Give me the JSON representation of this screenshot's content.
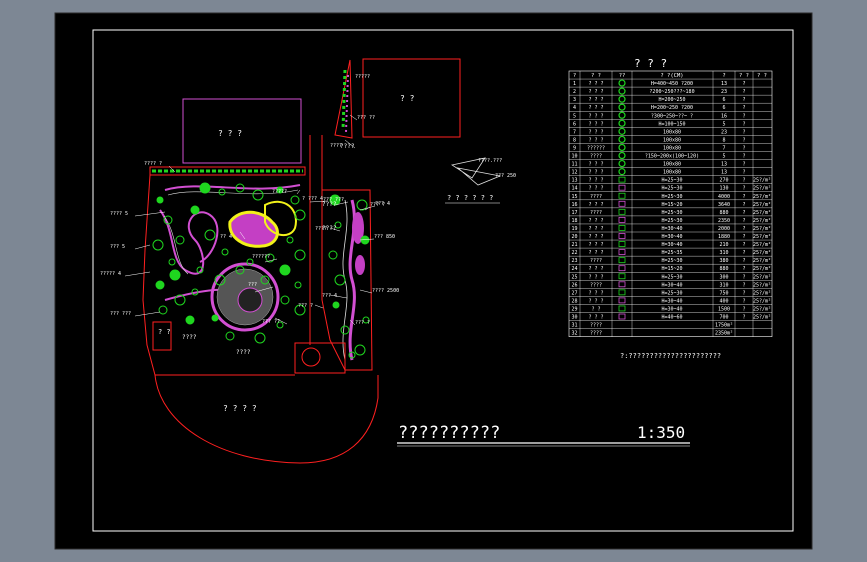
{
  "drawing": {
    "title": "??????????",
    "scale": "1:350",
    "note": "?:??????????????????????",
    "legend_title": "? ? ?",
    "detail_label": "? ? ? ? ? ?",
    "detail_annotations": [
      "????.???",
      "??? 250"
    ]
  },
  "plan_labels": {
    "building_top_left": "? ? ?",
    "building_top_right": "? ?",
    "lawn_south": "? ? ? ?",
    "entry": "????",
    "plaza": "????",
    "gate": "? ?",
    "north": "?????",
    "walk": "????",
    "drive": "????",
    "bridge": "????"
  },
  "callouts": [
    "???? ?",
    "???? 5",
    "??? 5",
    "????? 4",
    "??? ???",
    "?????",
    "?? 4",
    "??????",
    "???",
    "??? ??",
    "????",
    "????",
    "??? ?",
    "??? 4",
    "??? 4",
    "???? 2500",
    "??? 850",
    "??? ?",
    "??? ??",
    "? ??? 4",
    "??? ???",
    "??? ?"
  ],
  "table": {
    "headers": [
      "?",
      "? ?",
      "??",
      "? ?(CM)",
      "?",
      "? ?",
      "? ?"
    ],
    "rows": [
      [
        "1",
        "? ? ?",
        "",
        "H=400~450 ?200",
        "13",
        "?",
        ""
      ],
      [
        "2",
        "? ? ?",
        "",
        "?200~250???~180",
        "23",
        "?",
        ""
      ],
      [
        "3",
        "? ? ?",
        "",
        "H=200~250",
        "6",
        "?",
        ""
      ],
      [
        "4",
        "? ? ?",
        "",
        "H=200~250 ?200",
        "6",
        "?",
        ""
      ],
      [
        "5",
        "? ? ?",
        "",
        "?300~250~??~ ?",
        "16",
        "?",
        ""
      ],
      [
        "6",
        "? ? ?",
        "",
        "H=100~150",
        "5",
        "?",
        ""
      ],
      [
        "7",
        "? ? ?",
        "",
        "100x80",
        "23",
        "?",
        ""
      ],
      [
        "8",
        "? ? ?",
        "",
        "100x80",
        "8",
        "?",
        ""
      ],
      [
        "9",
        "??????",
        "",
        "100x80",
        "7",
        "?",
        ""
      ],
      [
        "10",
        "????",
        "",
        "?150~200x(100~120)",
        "5",
        "?",
        ""
      ],
      [
        "11",
        "? ? ?",
        "",
        "100x80",
        "13",
        "?",
        ""
      ],
      [
        "12",
        "? ? ?",
        "",
        "100x80",
        "13",
        "?",
        ""
      ],
      [
        "13",
        "? ? ?",
        "",
        "H=25~30",
        "270",
        "?",
        "25?/m²"
      ],
      [
        "14",
        "? ? ?",
        "",
        "H=25~30",
        "130",
        "?",
        "25?/m²"
      ],
      [
        "15",
        "????",
        "",
        "H=25~30",
        "4000",
        "?",
        "25?/m²"
      ],
      [
        "16",
        "? ? ?",
        "",
        "H=15~20",
        "3640",
        "?",
        "25?/m²"
      ],
      [
        "17",
        "????",
        "",
        "H=25~30",
        "880",
        "?",
        "25?/m²"
      ],
      [
        "18",
        "? ? ?",
        "",
        "H=25~30",
        "2350",
        "?",
        "25?/m²"
      ],
      [
        "19",
        "? ? ?",
        "",
        "H=30~40",
        "2000",
        "?",
        "25?/m²"
      ],
      [
        "20",
        "? ? ?",
        "",
        "H=30~40",
        "1880",
        "?",
        "25?/m²"
      ],
      [
        "21",
        "? ? ?",
        "",
        "H=30~40",
        "210",
        "?",
        "25?/m²"
      ],
      [
        "22",
        "? ? ?",
        "",
        "H=25~35",
        "310",
        "?",
        "25?/m²"
      ],
      [
        "23",
        "????",
        "",
        "H=25~30",
        "380",
        "?",
        "25?/m²"
      ],
      [
        "24",
        "? ? ?",
        "",
        "H=15~20",
        "880",
        "?",
        "25?/m²"
      ],
      [
        "25",
        "? ? ?",
        "",
        "H=25~30",
        "300",
        "?",
        "25?/m²"
      ],
      [
        "26",
        "????",
        "",
        "H=30~40",
        "310",
        "?",
        "25?/m²"
      ],
      [
        "27",
        "? ? ?",
        "",
        "H=25~30",
        "750",
        "?",
        "25?/m²"
      ],
      [
        "28",
        "? ? ?",
        "",
        "H=30~40",
        "400",
        "?",
        "25?/m²"
      ],
      [
        "29",
        "? ?",
        "",
        "H=30~40",
        "1500",
        "?",
        "25?/m²"
      ],
      [
        "30",
        "? ? ?",
        "",
        "H=40~60",
        "700",
        "?",
        "25?/m²"
      ],
      [
        "31",
        "????",
        "",
        "",
        "1750m²",
        "",
        ""
      ],
      [
        "32",
        "????",
        "",
        "",
        "2350m²",
        "",
        ""
      ]
    ]
  },
  "colors": {
    "paper": "#000000",
    "frame": "#ffffff",
    "boundary": "#ff2020",
    "planting": "#1fd61f",
    "flowers": "#d24fd2",
    "yellow": "#f2f21a",
    "path": "#e0e0e0"
  }
}
